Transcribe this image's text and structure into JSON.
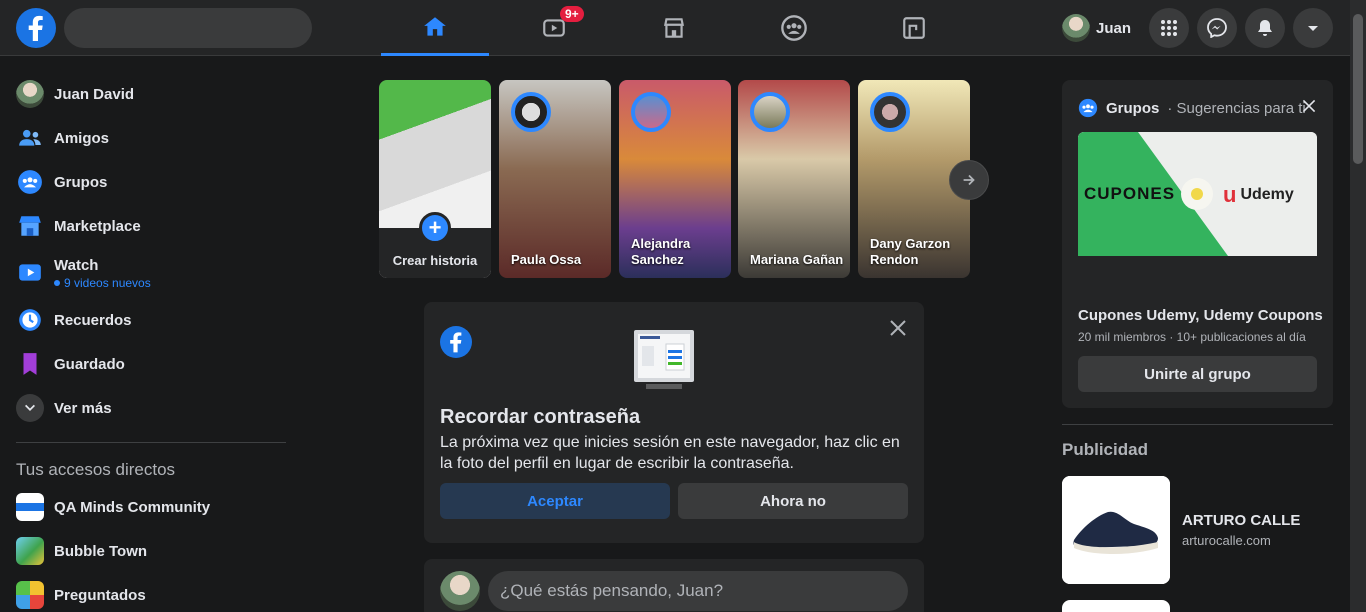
{
  "topbar": {
    "watch_badge": "9+",
    "profile_name": "Juan"
  },
  "sidebar": {
    "items": [
      {
        "label": "Juan David"
      },
      {
        "label": "Amigos"
      },
      {
        "label": "Grupos"
      },
      {
        "label": "Marketplace"
      },
      {
        "label": "Watch",
        "sub": "9 videos nuevos"
      },
      {
        "label": "Recuerdos"
      },
      {
        "label": "Guardado"
      },
      {
        "label": "Ver más"
      }
    ],
    "shortcuts_title": "Tus accesos directos",
    "shortcuts": [
      {
        "label": "QA Minds Community"
      },
      {
        "label": "Bubble Town"
      },
      {
        "label": "Preguntados"
      }
    ]
  },
  "stories": {
    "create_label": "Crear historia",
    "items": [
      {
        "name": "Paula Ossa"
      },
      {
        "name": "Alejandra Sanchez"
      },
      {
        "name": "Mariana Gañan"
      },
      {
        "name": "Dany Garzon Rendon"
      }
    ]
  },
  "password_card": {
    "title": "Recordar contraseña",
    "text": "La próxima vez que inicies sesión en este navegador, haz clic en la foto del perfil en lugar de escribir la contraseña.",
    "accept": "Aceptar",
    "later": "Ahora no"
  },
  "composer": {
    "placeholder": "¿Qué estás pensando, Juan?"
  },
  "groups_card": {
    "heading": "Grupos",
    "subheading": "· Sugerencias para ti",
    "banner_left": "CUPONES",
    "banner_right": "Udemy",
    "name": "Cupones Udemy, Udemy Coupons",
    "meta": "20 mil miembros · 10+ publicaciones al día",
    "join": "Unirte al grupo"
  },
  "ads": {
    "title": "Publicidad",
    "items": [
      {
        "brand": "ARTURO CALLE",
        "url": "arturocalle.com"
      }
    ]
  },
  "colors": {
    "accent": "#2d88ff",
    "badge": "#e41e3f",
    "background": "#18191a",
    "card": "#242526"
  }
}
